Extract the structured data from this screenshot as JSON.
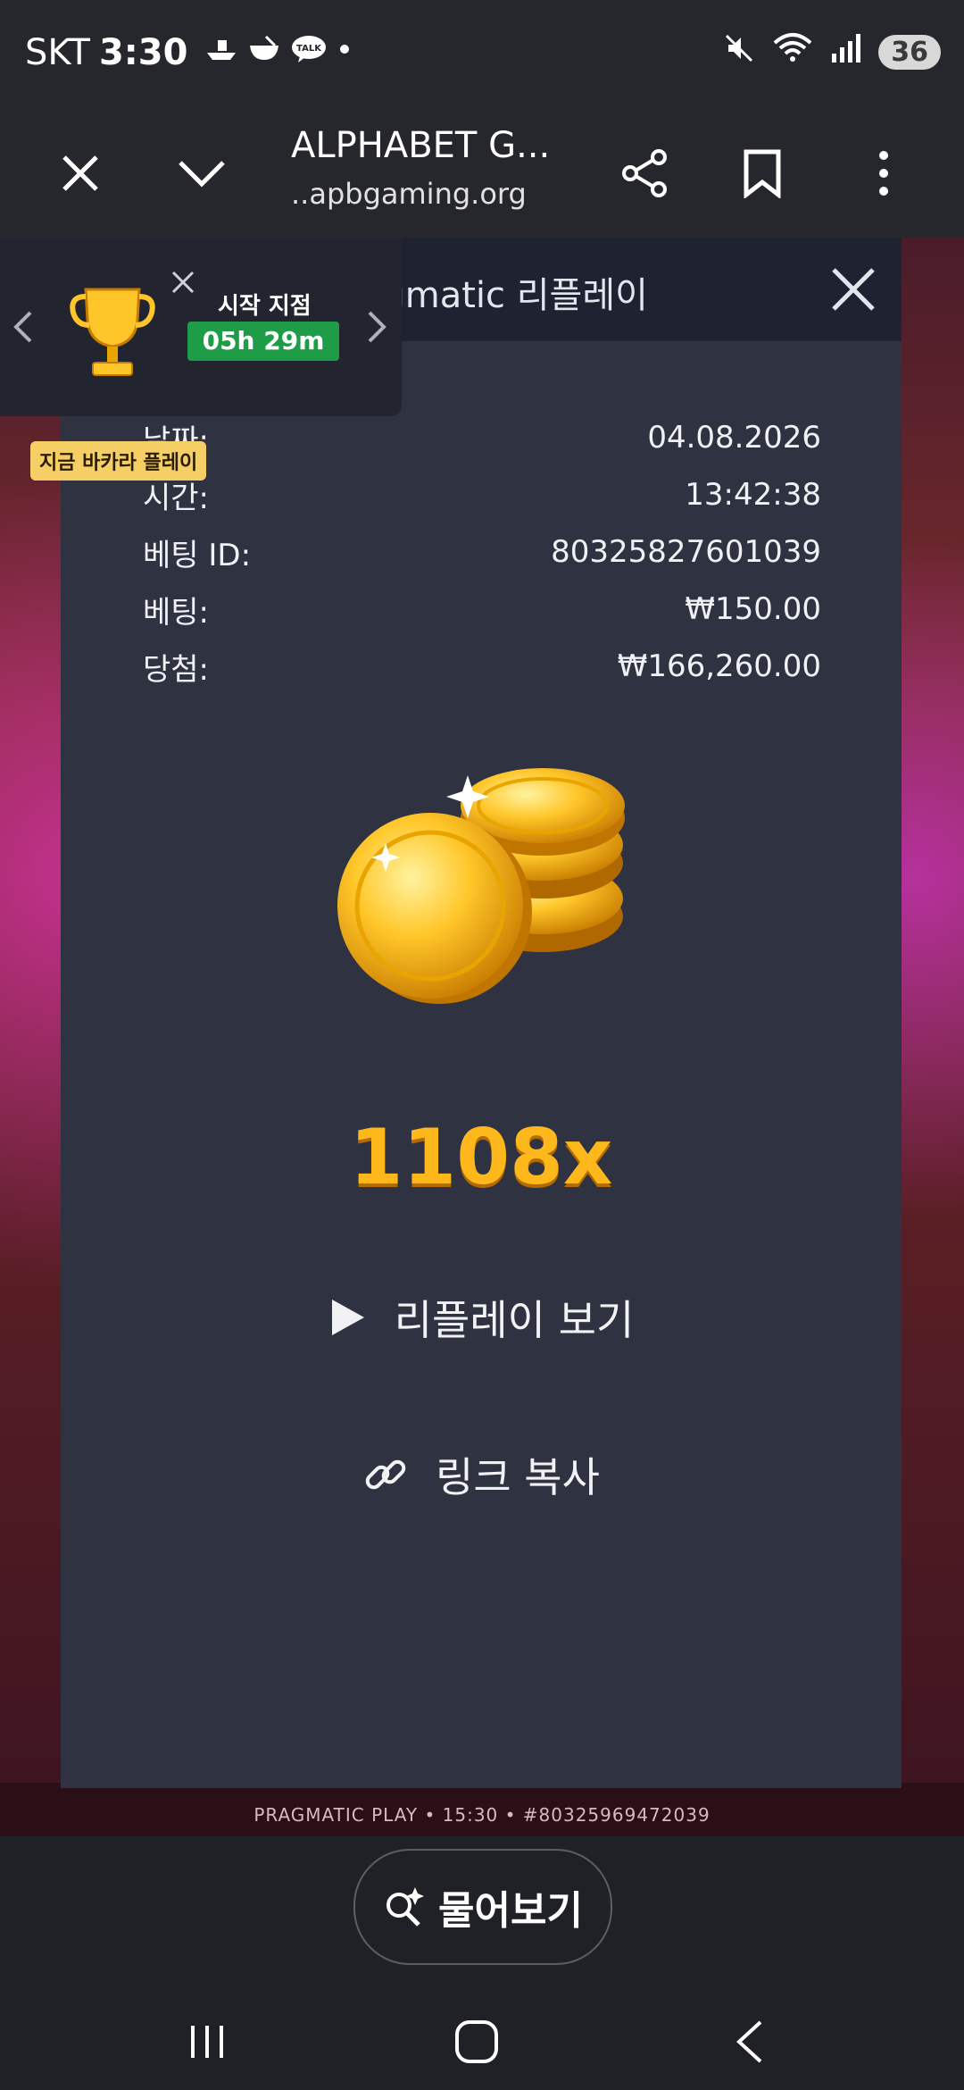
{
  "status": {
    "carrier": "SKT",
    "time": "3:30",
    "notification_icons": [
      "boat-icon",
      "bowl-icon",
      "talk-icon",
      "dot-icon"
    ],
    "talk_label": "TALK",
    "battery": "36"
  },
  "browser": {
    "title": "ALPHABET G...",
    "url": "..apbgaming.org"
  },
  "modal": {
    "title": "Pragmatic 리플레이",
    "details": [
      {
        "label": "날짜:",
        "value": "04.08.2026"
      },
      {
        "label": "시간:",
        "value": "13:42:38"
      },
      {
        "label": "베팅 ID:",
        "value": "80325827601039"
      },
      {
        "label": "베팅:",
        "value": "₩150.00"
      },
      {
        "label": "당첨:",
        "value": "₩166,260.00"
      }
    ],
    "multiplier": "1108x",
    "replay_label": "리플레이 보기",
    "copy_link_label": "링크 복사"
  },
  "tournament": {
    "label": "시작 지점",
    "timer": "05h 29m",
    "play_badge": "지금 바카라 플레이"
  },
  "game_footer": "PRAGMATIC PLAY • 15:30 • #80325969472039",
  "ask_button": "물어보기",
  "colors": {
    "accent_gold": "#ffb81c",
    "timer_green": "#1e9c48",
    "modal_bg": "#2f3241"
  }
}
